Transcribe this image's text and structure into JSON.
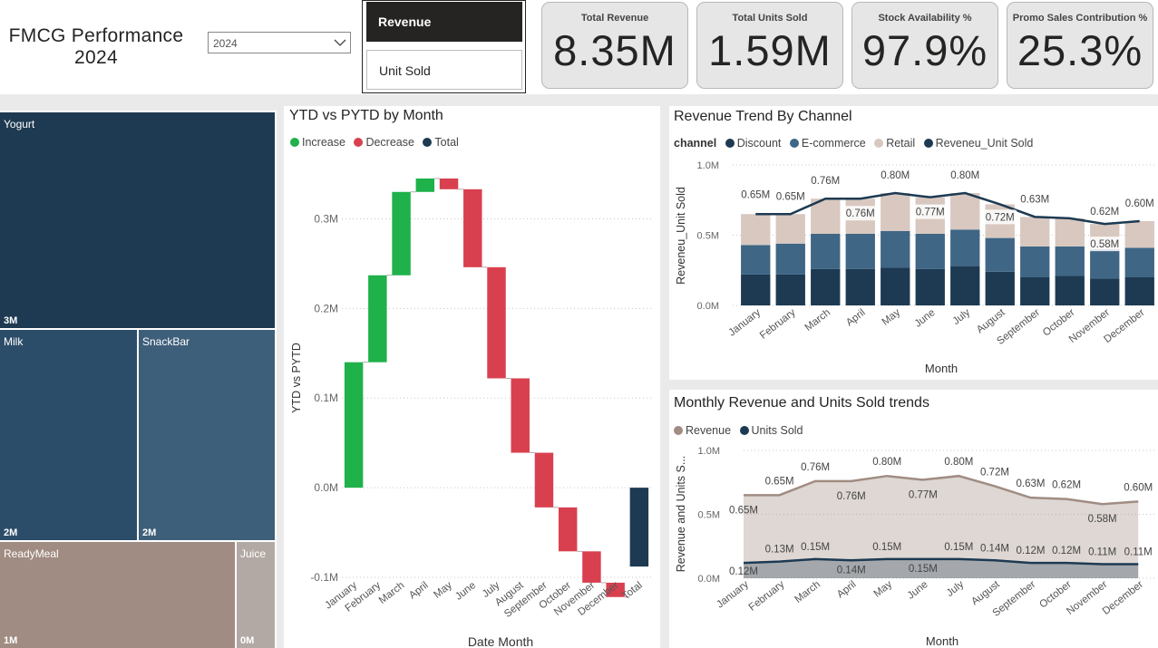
{
  "header": {
    "title_line1": "FMCG  Performance",
    "title_line2": "2024",
    "year_select": "2024",
    "buttons": [
      "Revenue",
      "Unit Sold"
    ]
  },
  "kpis": [
    {
      "title": "Total Revenue",
      "value": "8.35M"
    },
    {
      "title": "Total Units Sold",
      "value": "1.59M"
    },
    {
      "title": "Stock Availability %",
      "value": "97.9%"
    },
    {
      "title": "Promo Sales Contribution %",
      "value": "25.3%"
    }
  ],
  "treemap": {
    "tiles": [
      {
        "name": "Yogurt",
        "value": "3M",
        "color": "#1e3a52"
      },
      {
        "name": "Milk",
        "value": "2M",
        "color": "#2c4d69"
      },
      {
        "name": "SnackBar",
        "value": "2M",
        "color": "#3e5f7a"
      },
      {
        "name": "ReadyMeal",
        "value": "1M",
        "color": "#a08c82"
      },
      {
        "name": "Juice",
        "value": "0M",
        "color": "#b3a9a4"
      }
    ]
  },
  "colors": {
    "increase": "#1fb14a",
    "decrease": "#d9404f",
    "total": "#1d3a52",
    "discount": "#1d3a52",
    "ecommerce": "#3f6685",
    "retail": "#d8c8bf",
    "line": "#1d3a52",
    "revenue_area": "#a08c82",
    "units_area": "#1d3a52"
  },
  "chart_data": [
    {
      "type": "waterfall",
      "title": "YTD vs PYTD by Month",
      "legend": [
        "Increase",
        "Decrease",
        "Total"
      ],
      "xlabel": "Date Month",
      "ylabel": "YTD vs PYTD",
      "y_ticks": [
        "0.3M",
        "0.2M",
        "0.1M",
        "0.0M",
        "-0.1M"
      ],
      "ylim": [
        -0.1,
        0.35
      ],
      "categories": [
        "January",
        "February",
        "March",
        "April",
        "May",
        "June",
        "July",
        "August",
        "September",
        "October",
        "November",
        "December",
        "Total"
      ],
      "deltas": [
        0.14,
        0.097,
        0.093,
        0.015,
        -0.012,
        -0.087,
        -0.124,
        -0.083,
        -0.061,
        -0.049,
        -0.035,
        -0.016,
        null
      ],
      "total": -0.088
    },
    {
      "type": "bar",
      "stacked": true,
      "title": "Revenue Trend By Channel",
      "legend_title": "channel",
      "legend": [
        "Discount",
        "E-commerce",
        "Retail",
        "Reveneu_Unit Sold"
      ],
      "xlabel": "Month",
      "ylabel": "Reveneu_Unit Sold",
      "y_ticks": [
        "1.0M",
        "0.5M",
        "0.0M"
      ],
      "ylim": [
        0,
        1.0
      ],
      "categories": [
        "January",
        "February",
        "March",
        "April",
        "May",
        "June",
        "July",
        "August",
        "September",
        "October",
        "November",
        "December"
      ],
      "series": [
        {
          "name": "Discount",
          "values": [
            0.22,
            0.22,
            0.26,
            0.26,
            0.27,
            0.26,
            0.28,
            0.24,
            0.2,
            0.21,
            0.19,
            0.2
          ]
        },
        {
          "name": "E-commerce",
          "values": [
            0.21,
            0.22,
            0.25,
            0.25,
            0.26,
            0.25,
            0.26,
            0.24,
            0.22,
            0.21,
            0.21,
            0.21
          ]
        },
        {
          "name": "Retail",
          "values": [
            0.22,
            0.21,
            0.25,
            0.25,
            0.27,
            0.26,
            0.26,
            0.24,
            0.21,
            0.2,
            0.18,
            0.19
          ]
        }
      ],
      "line": {
        "name": "Reveneu_Unit Sold",
        "values": [
          0.65,
          0.65,
          0.76,
          0.76,
          0.8,
          0.77,
          0.8,
          0.72,
          0.63,
          0.62,
          0.58,
          0.6
        ]
      },
      "data_labels": [
        "0.65M",
        "0.65M",
        "0.76M",
        "0.76M",
        "0.80M",
        "0.77M",
        "0.80M",
        "0.72M",
        "0.63M",
        "",
        "0.62M",
        "0.58M",
        "0.60M"
      ]
    },
    {
      "type": "area",
      "title": "Monthly Revenue and Units Sold trends",
      "legend": [
        "Revenue",
        "Units Sold"
      ],
      "xlabel": "Month",
      "ylabel": "Revenue and Units S...",
      "y_ticks": [
        "1.0M",
        "0.5M",
        "0.0M"
      ],
      "ylim": [
        0,
        1.0
      ],
      "categories": [
        "January",
        "February",
        "March",
        "April",
        "May",
        "June",
        "July",
        "August",
        "September",
        "October",
        "November",
        "December"
      ],
      "series": [
        {
          "name": "Revenue",
          "values": [
            0.65,
            0.65,
            0.76,
            0.76,
            0.8,
            0.77,
            0.8,
            0.72,
            0.63,
            0.62,
            0.58,
            0.6
          ],
          "labels": [
            "0.65M",
            "0.65M",
            "0.76M",
            "0.76M",
            "0.80M",
            "0.77M",
            "0.80M",
            "0.72M",
            "0.63M",
            "0.62M",
            "0.58M",
            "0.60M"
          ]
        },
        {
          "name": "Units Sold",
          "values": [
            0.12,
            0.13,
            0.15,
            0.14,
            0.15,
            0.15,
            0.15,
            0.14,
            0.12,
            0.12,
            0.11,
            0.11
          ],
          "labels": [
            "0.12M",
            "0.13M",
            "0.15M",
            "0.14M",
            "0.15M",
            "0.15M",
            "0.15M",
            "0.14M",
            "0.12M",
            "0.12M",
            "0.11M",
            "0.11M"
          ]
        }
      ]
    }
  ]
}
